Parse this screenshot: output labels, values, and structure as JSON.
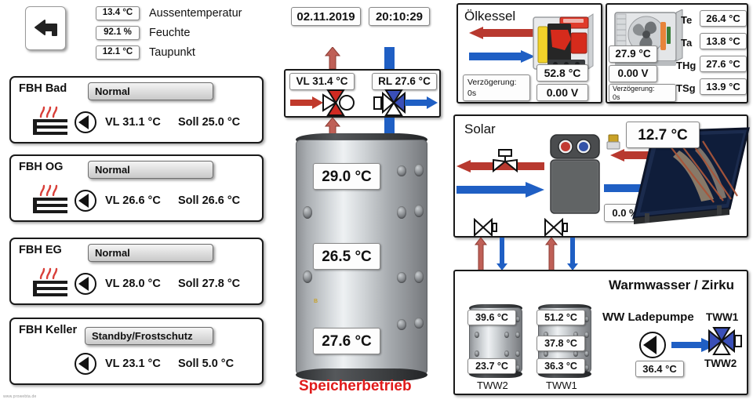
{
  "meta": {
    "watermark": "www.prowebta.de"
  },
  "header": {
    "back_icon": "back-arrow-icon",
    "readouts": [
      {
        "value": "13.4 °C",
        "label": "Aussentemperatur"
      },
      {
        "value": "92.1 %",
        "label": "Feuchte"
      },
      {
        "value": "12.1 °C",
        "label": "Taupunkt"
      }
    ],
    "date": "02.11.2019",
    "time": "20:10:29"
  },
  "circuits": [
    {
      "name": "FBH Bad",
      "mode": "Normal",
      "vl": "VL 31.1 °C",
      "soll": "Soll 25.0 °C",
      "has_floor_icon": true
    },
    {
      "name": "FBH OG",
      "mode": "Normal",
      "vl": "VL 26.6 °C",
      "soll": "Soll 26.6 °C",
      "has_floor_icon": true
    },
    {
      "name": "FBH EG",
      "mode": "Normal",
      "vl": "VL 28.0 °C",
      "soll": "Soll 27.8 °C",
      "has_floor_icon": true
    },
    {
      "name": "FBH Keller",
      "mode": "Standby/Frostschutz",
      "vl": "VL 23.1 °C",
      "soll": "Soll 5.0 °C",
      "has_floor_icon": false
    }
  ],
  "mixer": {
    "vl": "VL 31.4 °C",
    "rl": "RL 27.6 °C"
  },
  "buffer": {
    "top": "29.0 °C",
    "mid": "26.5 °C",
    "bottom": "27.6 °C",
    "status": "Speicherbetrieb"
  },
  "boiler": {
    "title": "Ölkessel",
    "temp": "52.8 °C",
    "voltage": "0.00 V",
    "delay_label": "Verzögerung:",
    "delay_value": "0s"
  },
  "ventilation": {
    "temp": "27.9 °C",
    "voltage": "0.00 V",
    "delay_label": "Verzögerung:",
    "delay_value": "0s",
    "rows": [
      {
        "key": "Te",
        "value": "26.4 °C"
      },
      {
        "key": "Ta",
        "value": "13.8 °C"
      },
      {
        "key": "THg",
        "value": "27.6 °C"
      },
      {
        "key": "TSg",
        "value": "13.9 °C"
      }
    ]
  },
  "solar": {
    "title": "Solar",
    "collector_temp": "12.7 °C",
    "pump_percent": "0.0 %"
  },
  "dhw": {
    "title": "Warmwasser / Zirku",
    "pump_label": "WW Ladepumpe",
    "pump_temp": "36.4 °C",
    "valve_top_label": "TWW1",
    "valve_bottom_label": "TWW2",
    "tanks": [
      {
        "label": "TWW2",
        "temps": [
          "39.6 °C",
          "23.7 °C"
        ]
      },
      {
        "label": "TWW1",
        "temps": [
          "51.2 °C",
          "37.8 °C",
          "36.3 °C"
        ]
      }
    ]
  },
  "colors": {
    "flow_red": "#c0392b",
    "return_blue": "#1f5fc4",
    "status_red": "#e01b1b"
  }
}
